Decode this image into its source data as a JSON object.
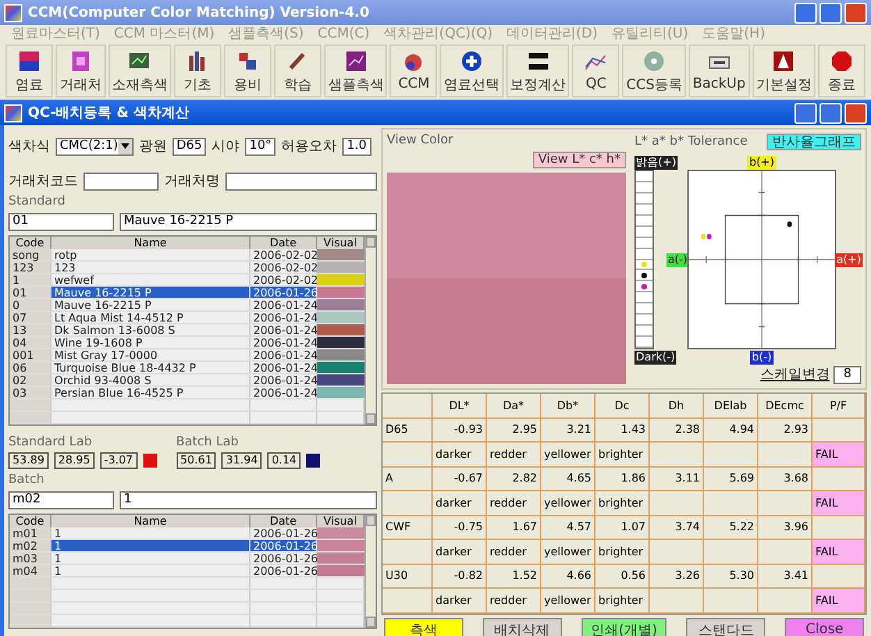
{
  "app_title": "CCM(Computer Color Matching) Version-4.0",
  "menu": [
    "원료마스터(T)",
    "CCM 마스터(M)",
    "샘플측색(S)",
    "CCM(C)",
    "색차관리(QC)(Q)",
    "데이터관리(D)",
    "유틸리티(U)",
    "도움말(H)"
  ],
  "toolbar": [
    "염료",
    "거래처",
    "소재측색",
    "기초",
    "용비",
    "학습",
    "샘플측색",
    "CCM",
    "염료선택",
    "보정계산",
    "QC",
    "CCS등록",
    "BackUp",
    "기본설정",
    "종료"
  ],
  "qc_window": {
    "title": "QC-배치등록 & 색차계산",
    "formula_label": "색차식",
    "formula": "CMC(2:1)",
    "illuminant_label": "광원",
    "illuminant": "D65",
    "observer_label": "시야",
    "observer": "10°",
    "tolerance_label": "허용오차",
    "tolerance": "1.0",
    "customer_code_label": "거래처코드",
    "customer_name_label": "거래처명",
    "standard": {
      "label": "Standard",
      "code": "01",
      "name": "Mauve 16-2215 P"
    },
    "standard_columns": [
      "Code",
      "Name",
      "Date",
      "Visual"
    ],
    "standard_rows": [
      {
        "code": "song",
        "name": "rotp",
        "date": "2006-02-02",
        "color": "#a08a86",
        "selected": false
      },
      {
        "code": "123",
        "name": "123",
        "date": "2006-02-02",
        "color": "#b4b0b2",
        "selected": false
      },
      {
        "code": "1",
        "name": "wefwef",
        "date": "2006-02-02",
        "color": "#d8d010",
        "selected": false
      },
      {
        "code": "01",
        "name": "Mauve 16-2215 P",
        "date": "2006-01-26",
        "color": "#c87a94",
        "selected": true
      },
      {
        "code": "0",
        "name": "Mauve 16-2215 P",
        "date": "2006-01-24",
        "color": "#9a7e98",
        "selected": false
      },
      {
        "code": "07",
        "name": "Lt Aqua Mist 14-4512 P",
        "date": "2006-01-24",
        "color": "#a8c8c0",
        "selected": false
      },
      {
        "code": "13",
        "name": "Dk Salmon 13-6008 S",
        "date": "2006-01-24",
        "color": "#b05a50",
        "selected": false
      },
      {
        "code": "04",
        "name": "Wine 19-1608 P",
        "date": "2006-01-24",
        "color": "#2c3040",
        "selected": false
      },
      {
        "code": "001",
        "name": "Mist Gray 17-0000",
        "date": "2006-01-24",
        "color": "#8a8a8c",
        "selected": false
      },
      {
        "code": "06",
        "name": "Turquoise Blue 18-4432 P",
        "date": "2006-01-24",
        "color": "#1a8070",
        "selected": false
      },
      {
        "code": "02",
        "name": "Orchid 93-4008 S",
        "date": "2006-01-24",
        "color": "#4a4880",
        "selected": false
      },
      {
        "code": "03",
        "name": "Persian Blue 16-4525 P",
        "date": "2006-01-24",
        "color": "#7ab8b0",
        "selected": false
      }
    ],
    "standard_lab": {
      "label": "Standard Lab",
      "values": [
        "53.89",
        "28.95",
        "-3.07"
      ],
      "color": "#e01010"
    },
    "batch_lab": {
      "label": "Batch Lab",
      "values": [
        "50.61",
        "31.94",
        "0.14"
      ],
      "color": "#101070"
    },
    "batch": {
      "label": "Batch",
      "code": "m02",
      "name": "1"
    },
    "batch_columns": [
      "Code",
      "Name",
      "Date",
      "Visual"
    ],
    "batch_rows": [
      {
        "code": "m01",
        "name": "1",
        "date": "2006-01-26",
        "color": "#c98aa0",
        "selected": false
      },
      {
        "code": "m02",
        "name": "1",
        "date": "2006-01-26",
        "color": "#c9839a",
        "selected": true
      },
      {
        "code": "m03",
        "name": "1",
        "date": "2006-01-26",
        "color": "#c48096",
        "selected": false
      },
      {
        "code": "m04",
        "name": "1",
        "date": "2006-01-26",
        "color": "#c27c92",
        "selected": false
      }
    ],
    "view_color": {
      "label": "View Color",
      "button": "View L* c* h*"
    },
    "tolerance_panel": {
      "label": "L*  a*  b* Tolerance",
      "graph_button": "반사율그래프",
      "l_plus": "밝음(+)",
      "l_minus": "Dark(-)",
      "a_plus": "a(+)",
      "a_minus": "a(-)",
      "b_plus": "b(+)",
      "b_minus": "b(-)",
      "scale_label": "스케일변경",
      "scale_value": "8"
    },
    "results": {
      "columns": [
        "DL*",
        "Da*",
        "Db*",
        "Dc",
        "Dh",
        "DElab",
        "DEcmc",
        "P/F"
      ],
      "rows": [
        {
          "illuminant": "D65",
          "values": [
            "-0.93",
            "2.95",
            "3.21",
            "1.43",
            "2.38",
            "4.94",
            "2.93"
          ],
          "descriptions": [
            "darker",
            "redder",
            "yellower",
            "brighter"
          ],
          "result": "FAIL"
        },
        {
          "illuminant": "A",
          "values": [
            "-0.67",
            "2.82",
            "4.65",
            "1.86",
            "3.11",
            "5.69",
            "3.68"
          ],
          "descriptions": [
            "darker",
            "redder",
            "yellower",
            "brighter"
          ],
          "result": "FAIL"
        },
        {
          "illuminant": "CWF",
          "values": [
            "-0.75",
            "1.67",
            "4.57",
            "1.07",
            "3.74",
            "5.22",
            "3.96"
          ],
          "descriptions": [
            "darker",
            "redder",
            "yellower",
            "brighter"
          ],
          "result": "FAIL"
        },
        {
          "illuminant": "U30",
          "values": [
            "-0.82",
            "1.52",
            "4.66",
            "0.56",
            "3.26",
            "5.30",
            "3.41"
          ],
          "descriptions": [
            "darker",
            "redder",
            "yellower",
            "brighter"
          ],
          "result": "FAIL"
        }
      ]
    },
    "buttons": [
      {
        "label": "측색",
        "color": "#ffff00"
      },
      {
        "label": "배치삭제",
        "color": "#d8d4cc"
      },
      {
        "label": "인쇄(개별)",
        "color": "#80f080"
      },
      {
        "label": "스탠다드",
        "color": "#d8d4cc"
      },
      {
        "label": "Close",
        "color": "#f080f0"
      }
    ]
  }
}
